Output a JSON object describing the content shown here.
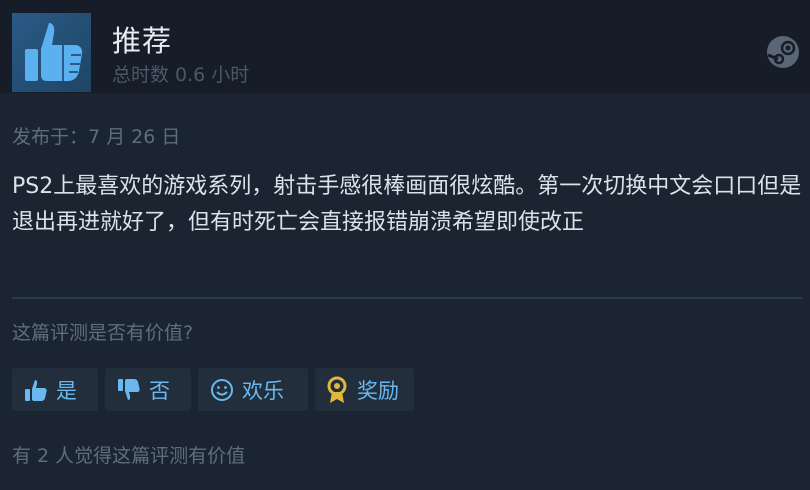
{
  "review": {
    "recommendation": "推荐",
    "hours": "总时数 0.6 小时",
    "posted": "发布于：7 月 26 日",
    "text": "PS2上最喜欢的游戏系列，射击手感很棒画面很炫酷。第一次切换中文会口口但是退出再进就好了，但有时死亡会直接报错崩溃希望即使改正"
  },
  "feedback": {
    "question": "这篇评测是否有价值?",
    "buttons": {
      "yes": "是",
      "no": "否",
      "funny": "欢乐",
      "award": "奖励"
    },
    "helpful_count": "有 2 人觉得这篇评测有价值"
  },
  "icons": {
    "recommendation": "thumbs-up-icon",
    "platform": "steam-logo-icon",
    "yes": "thumbs-up-icon",
    "no": "thumbs-down-icon",
    "funny": "smiley-icon",
    "award": "award-medal-icon"
  },
  "colors": {
    "background": "#1b2431",
    "header": "#161d28",
    "accent_blue": "#69b9f0",
    "award_gold": "#e0b93a"
  }
}
